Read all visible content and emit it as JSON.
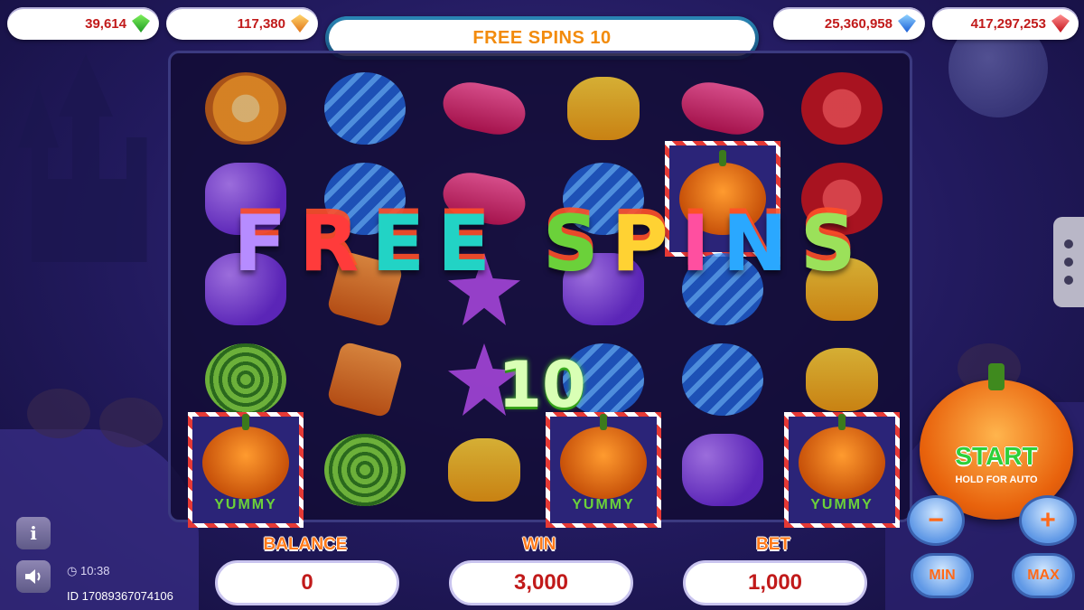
{
  "jackpots": [
    {
      "value": "39,614",
      "gem": "green-gem-icon",
      "color": "#2ea82e"
    },
    {
      "value": "117,380",
      "gem": "orange-gem-icon",
      "color": "#f08a1a"
    },
    {
      "value": "25,360,958",
      "gem": "blue-gem-icon",
      "color": "#2a6ee0"
    },
    {
      "value": "417,297,253",
      "gem": "red-gem-icon",
      "color": "#d0141c"
    }
  ],
  "header": {
    "title": "FREE SPINS 10"
  },
  "overlay": {
    "letters": [
      "F",
      "R",
      "E",
      "E",
      " ",
      "S",
      "P",
      "I",
      "N",
      "S"
    ],
    "count": "10"
  },
  "reels": {
    "symbols": [
      [
        "orange",
        "blue",
        "jelly",
        "gum",
        "jelly",
        "red"
      ],
      [
        "grape",
        "blue",
        "jelly",
        "blue",
        "pumpkin",
        "red"
      ],
      [
        "grape",
        "square",
        "star",
        "grape",
        "blue",
        "gum"
      ],
      [
        "swirl",
        "square",
        "star",
        "blue",
        "blue",
        "gum"
      ],
      [
        "pumpkin",
        "swirl",
        "gum",
        "pumpkin",
        "grape",
        "pumpkin"
      ]
    ],
    "wild_label": "YUMMY"
  },
  "bottom": {
    "balance_label": "BALANCE",
    "balance": "0",
    "win_label": "WIN",
    "win": "3,000",
    "bet_label": "BET",
    "bet": "1,000"
  },
  "info": {
    "info_icon": "info-icon",
    "sound_icon": "speaker-icon",
    "time": "10:38",
    "round_id": "ID 17089367074106"
  },
  "controls": {
    "start_label": "START",
    "hold_label": "HOLD FOR AUTO",
    "minus": "−",
    "plus": "+",
    "min_label": "MIN",
    "max_label": "MAX"
  },
  "colors": {
    "accent": "#ff7a1a",
    "value_red": "#c11a1a",
    "start_green": "#2ecf3a"
  }
}
